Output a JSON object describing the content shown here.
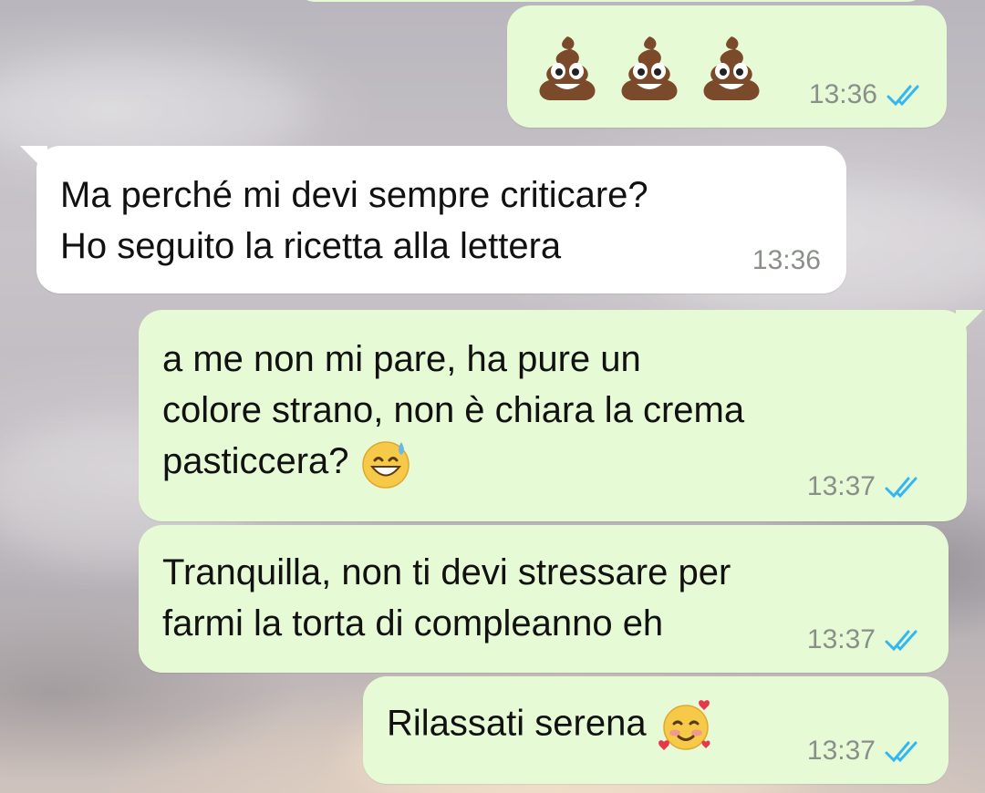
{
  "messages": [
    {
      "direction": "outgoing",
      "emojis": [
        "poop-emoji",
        "poop-emoji",
        "poop-emoji"
      ],
      "time": "13:36",
      "status": "read"
    },
    {
      "direction": "incoming",
      "text": "Ma perché mi devi sempre criticare?\nHo seguito la ricetta alla lettera",
      "time": "13:36"
    },
    {
      "direction": "outgoing",
      "text": "a me non mi pare, ha pure un\ncolore strano, non è chiara la crema\npasticcera?",
      "emoji": "grinning-sweat-emoji",
      "time": "13:37",
      "status": "read"
    },
    {
      "direction": "outgoing",
      "text": "Tranquilla, non ti devi stressare per\nfarmi la torta di compleanno eh",
      "time": "13:37",
      "status": "read"
    },
    {
      "direction": "outgoing",
      "text": "Rilassati serena",
      "emoji": "smiling-face-with-hearts-emoji",
      "time": "13:37",
      "status": "read"
    }
  ],
  "colors": {
    "outgoing_bubble": "#e6fad6",
    "incoming_bubble": "#ffffff",
    "read_ticks": "#34b7f1",
    "timestamp": "#8a8f8a"
  }
}
